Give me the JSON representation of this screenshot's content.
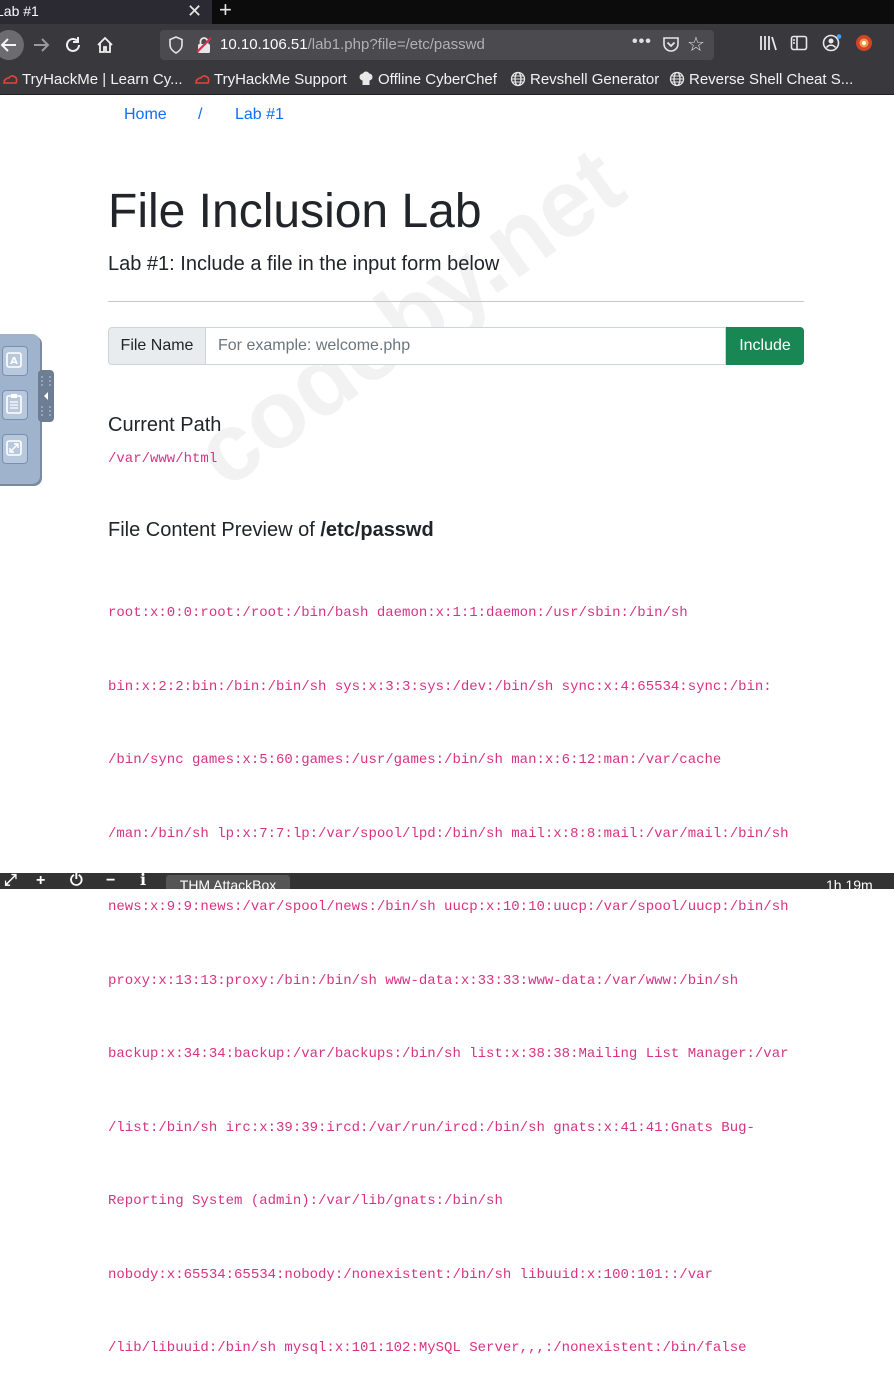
{
  "browser": {
    "tab_title": "Lab #1",
    "tab_close": "✕",
    "new_tab": "+",
    "url_host": "10.10.106.51",
    "url_path": "/lab1.php?file=/etc/passwd",
    "url_more": "•••",
    "bookmarks": [
      {
        "label": "TryHackMe | Learn Cy..."
      },
      {
        "label": "TryHackMe Support"
      },
      {
        "label": "Offline CyberChef"
      },
      {
        "label": "Revshell Generator"
      },
      {
        "label": "Reverse Shell Cheat S..."
      }
    ]
  },
  "breadcrumb": {
    "home": "Home",
    "separator": "/",
    "current": "Lab #1"
  },
  "page": {
    "title": "File Inclusion Lab",
    "subtitle": "Lab #1: Include a file in the input form below",
    "form": {
      "label": "File Name",
      "placeholder": "For example: welcome.php",
      "value": "",
      "button": "Include"
    },
    "current_path_heading": "Current Path",
    "current_path": "/var/www/html",
    "preview_heading_prefix": "File Content Preview of ",
    "preview_file": "/etc/passwd",
    "preview_lines": [
      "root:x:0:0:root:/root:/bin/bash daemon:x:1:1:daemon:/usr/sbin:/bin/sh",
      "bin:x:2:2:bin:/bin:/bin/sh sys:x:3:3:sys:/dev:/bin/sh sync:x:4:65534:sync:/bin:",
      "/bin/sync games:x:5:60:games:/usr/games:/bin/sh man:x:6:12:man:/var/cache",
      "/man:/bin/sh lp:x:7:7:lp:/var/spool/lpd:/bin/sh mail:x:8:8:mail:/var/mail:/bin/sh",
      "news:x:9:9:news:/var/spool/news:/bin/sh uucp:x:10:10:uucp:/var/spool/uucp:/bin/sh",
      "proxy:x:13:13:proxy:/bin:/bin/sh www-data:x:33:33:www-data:/var/www:/bin/sh",
      "backup:x:34:34:backup:/var/backups:/bin/sh list:x:38:38:Mailing List Manager:/var",
      "/list:/bin/sh irc:x:39:39:ircd:/var/run/ircd:/bin/sh gnats:x:41:41:Gnats Bug-",
      "Reporting System (admin):/var/lib/gnats:/bin/sh",
      "nobody:x:65534:65534:nobody:/nonexistent:/bin/sh libuuid:x:100:101::/var",
      "/lib/libuuid:/bin/sh mysql:x:101:102:MySQL Server,,,:/nonexistent:/bin/false"
    ],
    "watermark": "codeby.net"
  },
  "taskbar": {
    "item": "THM AttackBox",
    "clock": "1h 19m"
  },
  "colors": {
    "link": "#0d6efd",
    "code": "#d63384",
    "button": "#198754"
  }
}
